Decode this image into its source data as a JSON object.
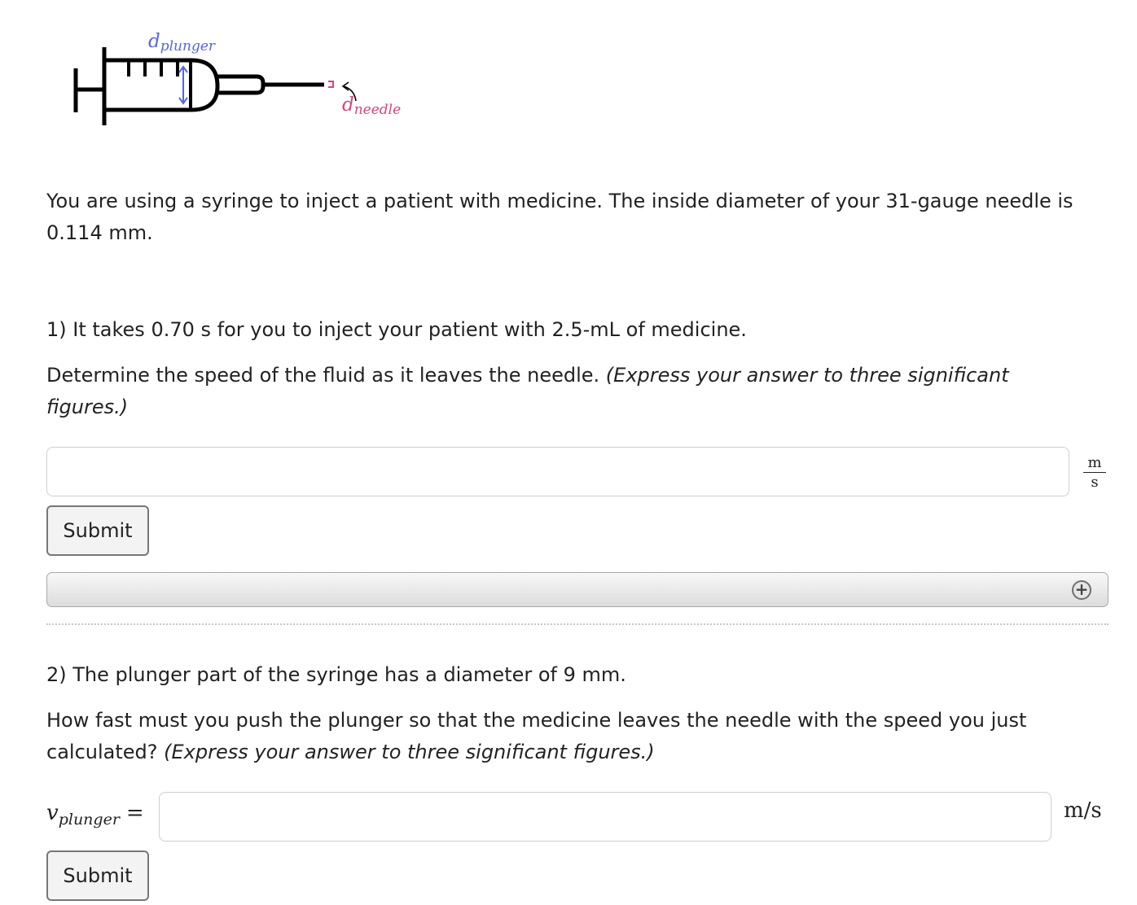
{
  "figure": {
    "plunger_label_main": "d",
    "plunger_label_sub": "plunger",
    "needle_label_main": "d",
    "needle_label_sub": "needle",
    "colors": {
      "plunger": "#5566dd",
      "needle": "#d9437a",
      "syringe": "#000000"
    }
  },
  "intro": {
    "text": "You are using a syringe to inject a patient with medicine. The inside diameter of your 31-gauge needle is 0.114 mm."
  },
  "question1": {
    "text": "1) It takes 0.70 s for you to inject your patient with 2.5-mL of medicine.",
    "prompt": "Determine the speed of the fluid as it leaves the needle.",
    "instruction": "(Express your answer to three significant figures.)",
    "input_value": "",
    "unit_numerator": "m",
    "unit_denominator": "s",
    "submit_label": "Submit",
    "expand_icon": "plus-circle-icon"
  },
  "question2": {
    "text": "2) The plunger part of the syringe has a diameter of 9 mm.",
    "prompt": "How fast must you push the plunger so that the medicine leaves the needle with the speed you just calculated?",
    "instruction": "(Express your answer to three significant figures.)",
    "variable_main": "v",
    "variable_sub": "plunger",
    "equals": "=",
    "input_value": "",
    "unit": "m/s",
    "submit_label": "Submit"
  }
}
